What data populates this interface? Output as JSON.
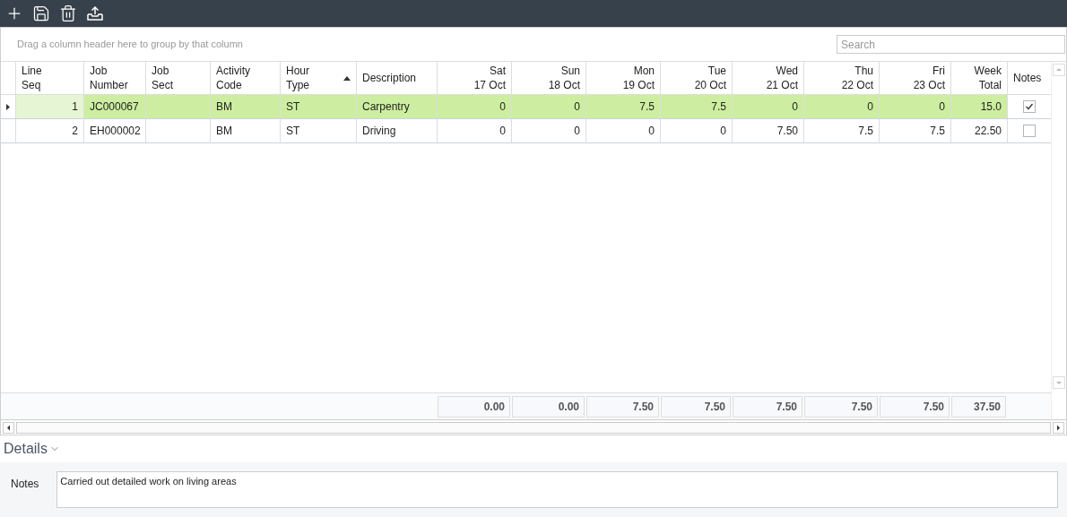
{
  "group_panel": {
    "hint": "Drag a column header here to group by that column"
  },
  "search": {
    "placeholder": "Search"
  },
  "columns": [
    {
      "label": "Line\nSeq",
      "kind": "seq"
    },
    {
      "label": "Job\nNumber",
      "kind": "text"
    },
    {
      "label": "Job\nSect",
      "kind": "text"
    },
    {
      "label": "Activity\nCode",
      "kind": "text"
    },
    {
      "label": "Hour\nType",
      "kind": "text",
      "sorted": true
    },
    {
      "label": "Description",
      "kind": "text"
    },
    {
      "label": "Sat\n17 Oct",
      "kind": "number"
    },
    {
      "label": "Sun\n18 Oct",
      "kind": "number"
    },
    {
      "label": "Mon\n19 Oct",
      "kind": "number"
    },
    {
      "label": "Tue\n20 Oct",
      "kind": "number"
    },
    {
      "label": "Wed\n21 Oct",
      "kind": "number"
    },
    {
      "label": "Thu\n22 Oct",
      "kind": "number"
    },
    {
      "label": "Fri\n23 Oct",
      "kind": "number"
    },
    {
      "label": "Week\nTotal",
      "kind": "number"
    },
    {
      "label": "Notes",
      "kind": "check"
    }
  ],
  "rows": [
    {
      "selected": true,
      "cells": [
        "1",
        "JC000067",
        "",
        "BM",
        "ST",
        "Carpentry",
        "0",
        "0",
        "7.5",
        "7.5",
        "0",
        "0",
        "0",
        "15.0"
      ],
      "notes_checked": true
    },
    {
      "selected": false,
      "cells": [
        "2",
        "EH000002",
        "",
        "BM",
        "ST",
        "Driving",
        "0",
        "0",
        "0",
        "0",
        "7.50",
        "7.5",
        "7.5",
        "22.50"
      ],
      "notes_checked": false
    }
  ],
  "totals": [
    "0.00",
    "0.00",
    "7.50",
    "7.50",
    "7.50",
    "7.50",
    "7.50",
    "37.50"
  ],
  "details": {
    "title": "Details",
    "expanded": true,
    "notes_label": "Notes",
    "notes_value": "Carried out detailed work on living areas"
  }
}
